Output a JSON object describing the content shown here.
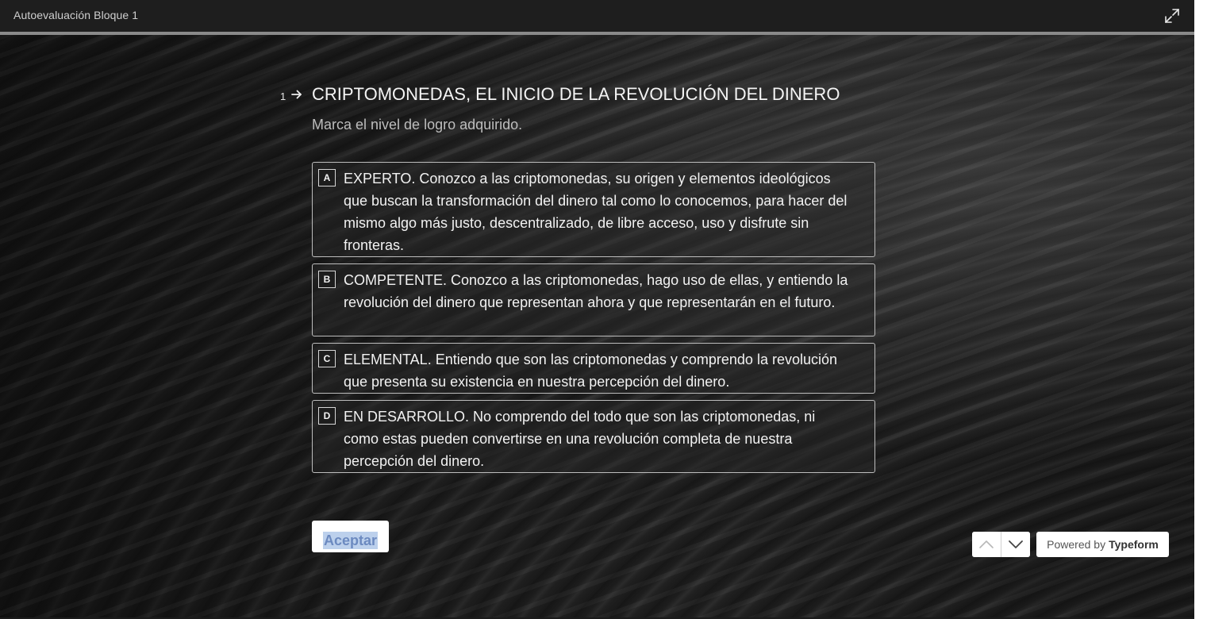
{
  "window": {
    "title": "Autoevaluación Bloque 1",
    "expand_icon": "expand-icon"
  },
  "progress": {
    "value": 1.0
  },
  "question": {
    "number": "1",
    "title": "CRIPTOMONEDAS, EL INICIO DE LA REVOLUCIÓN DEL DINERO",
    "subtitle": "Marca el nivel de logro adquirido.",
    "options": [
      {
        "key": "A",
        "text": "EXPERTO. Conozco a las criptomonedas, su origen y elementos ideológicos que buscan la transformación del dinero tal como lo conocemos, para hacer del mismo algo más justo, descentralizado, de libre acceso, uso y disfrute sin fronteras."
      },
      {
        "key": "B",
        "text": "COMPETENTE. Conozco a las criptomonedas, hago uso de ellas, y entiendo la revolución del dinero que representan ahora y que representarán en el futuro."
      },
      {
        "key": "C",
        "text": "ELEMENTAL. Entiendo que son las criptomonedas y comprendo la revolución que presenta su existencia en nuestra percepción del dinero."
      },
      {
        "key": "D",
        "text": "EN DESARROLLO. No comprendo del todo que son las criptomonedas, ni como estas pueden convertirse en una revolución completa de nuestra percepción del dinero."
      }
    ],
    "accept_label": "Aceptar"
  },
  "footer": {
    "powered_prefix": "Powered by",
    "powered_brand": "Typeform"
  }
}
